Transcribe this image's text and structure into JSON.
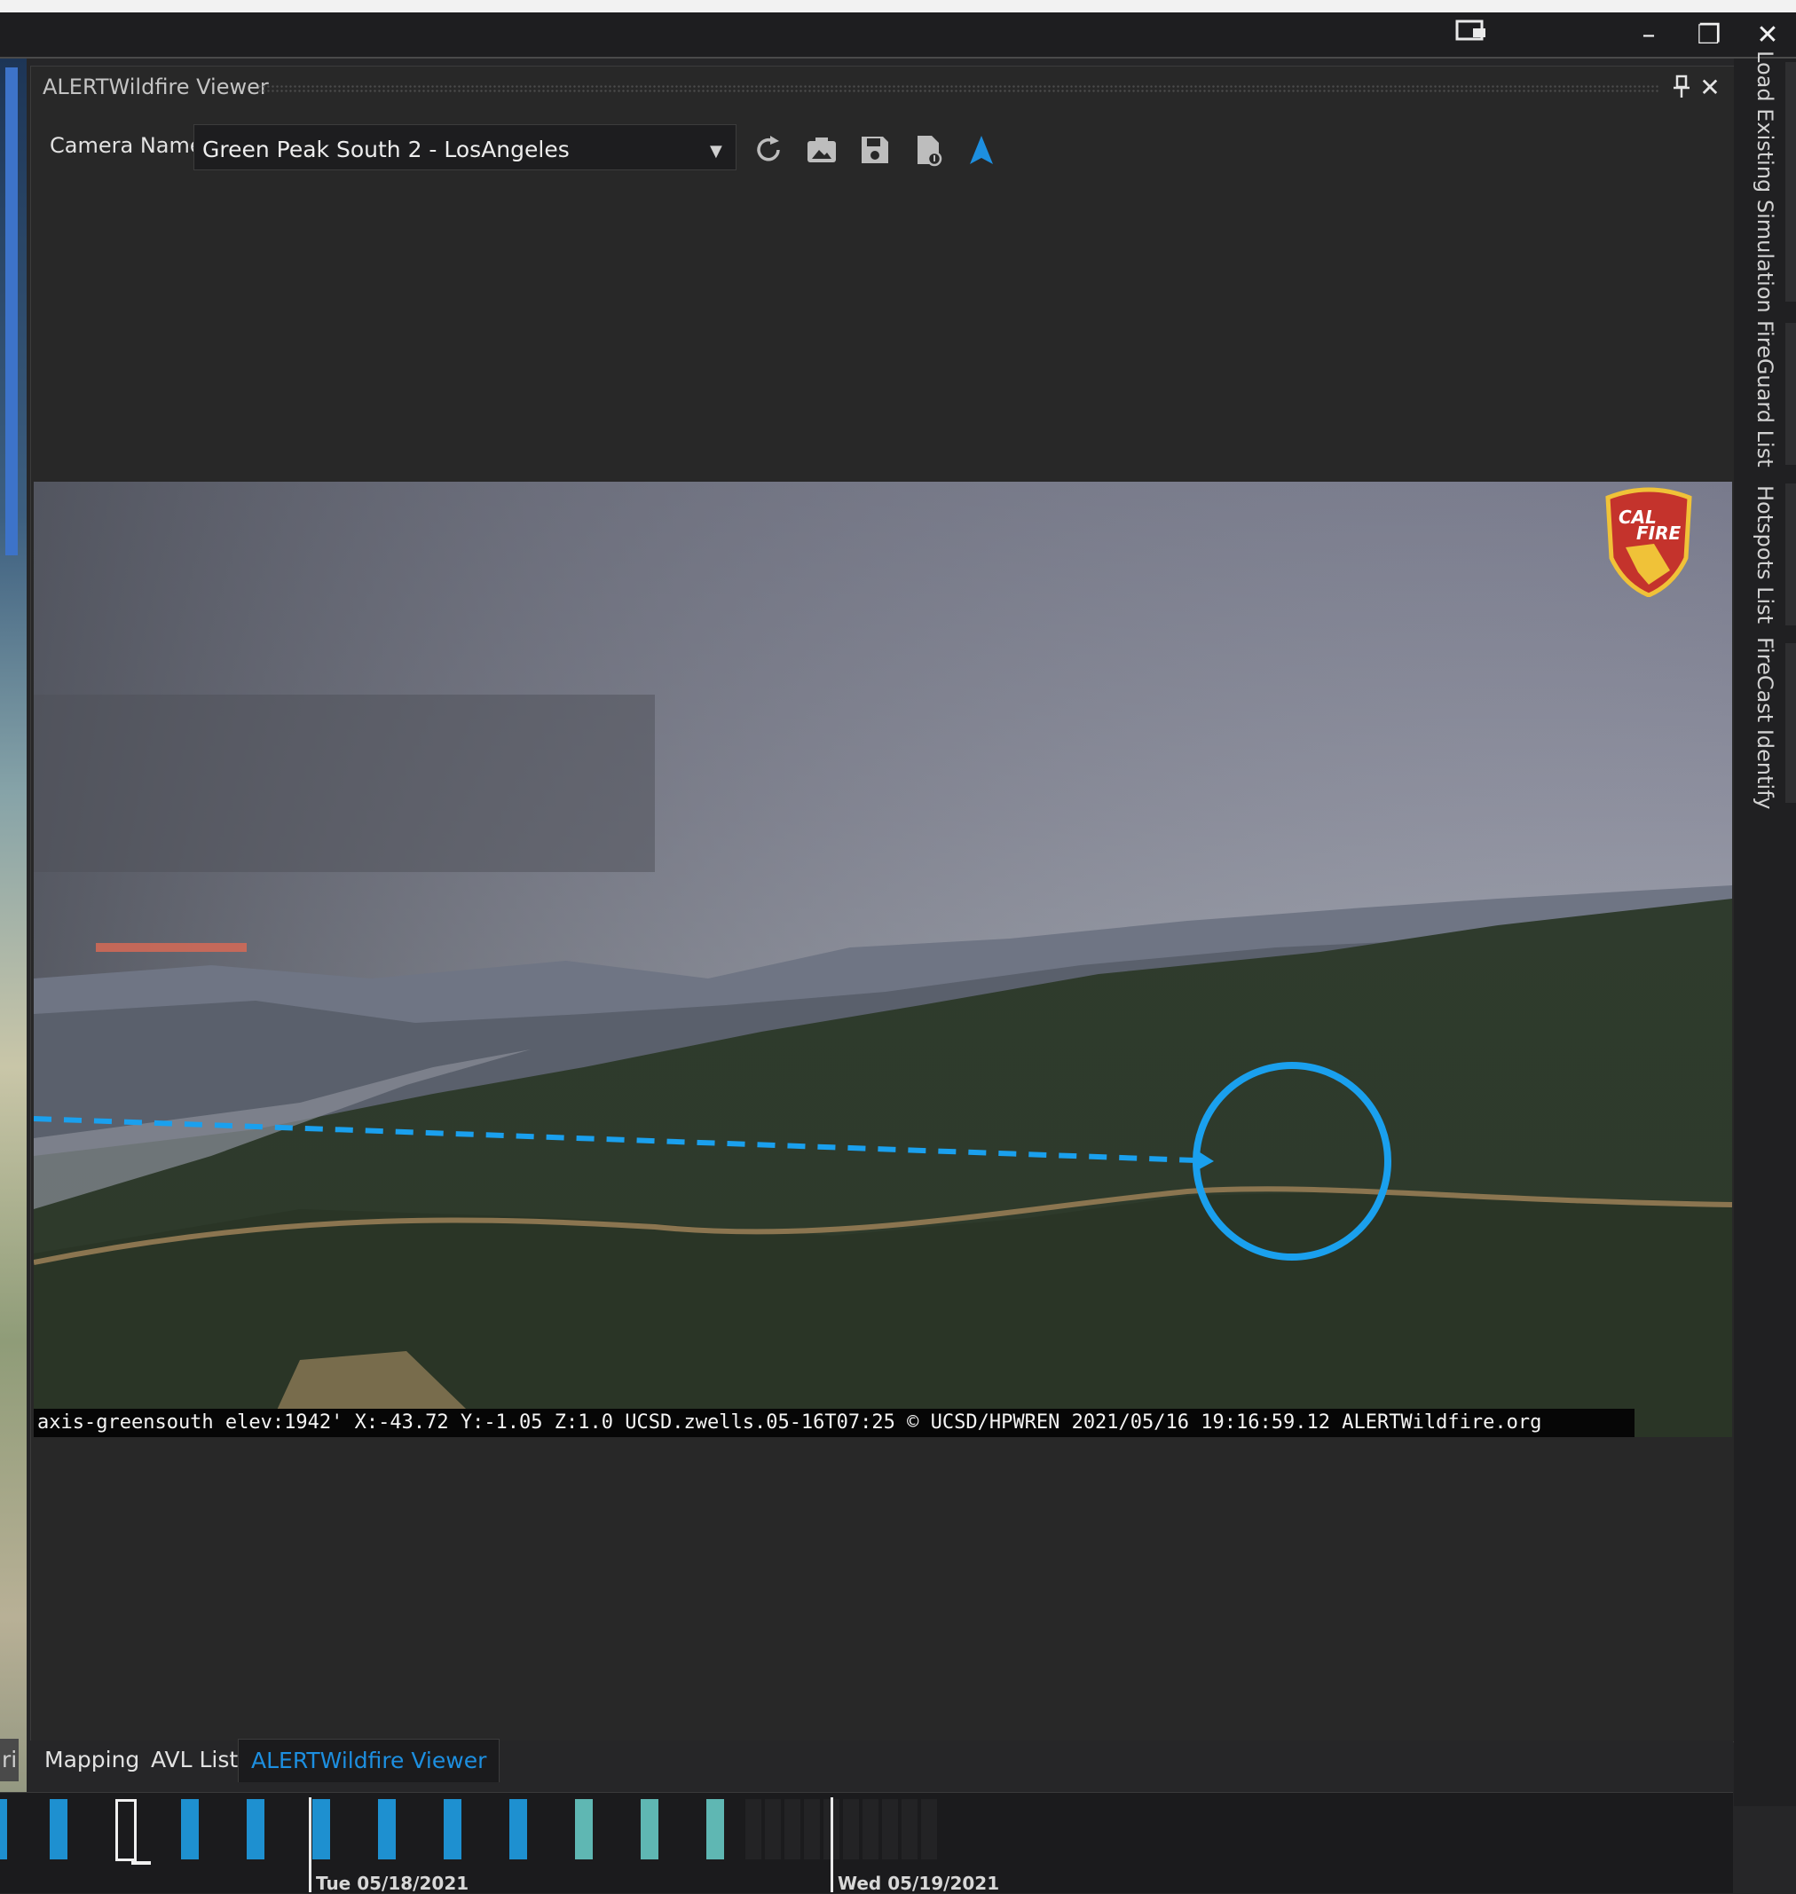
{
  "window": {
    "minimize_glyph": "–",
    "restore_glyph": "❐",
    "close_glyph": "✕"
  },
  "panel": {
    "title": "ALERTWildfire Viewer",
    "camera_label": "Camera Name",
    "camera_value": "Green Peak South 2 - LosAngeles",
    "pin_glyph": "🖈",
    "close_glyph": "✕"
  },
  "feed": {
    "info_text": "axis-greensouth elev:1942' X:-43.72 Y:-1.05 Z:1.0 UCSD.zwells.05-16T07:25 © UCSD/HPWREN 2021/05/16 19:16:59.12 ALERTWildfire.org",
    "logo_line1": "CAL",
    "logo_line2": "FIRE"
  },
  "side_tabs": [
    {
      "label": "Load Existing Simulation"
    },
    {
      "label": "FireGuard List"
    },
    {
      "label": "Hotspots List"
    },
    {
      "label": "FireCast Identify"
    }
  ],
  "bottom_tabs": {
    "partial": "ri",
    "mapping": "Mapping",
    "avl": "AVL List",
    "viewer": "ALERTWildfire Viewer"
  },
  "timeline": {
    "date1": "Tue 05/18/2021",
    "date2": "Wed 05/19/2021"
  },
  "colors": {
    "accent": "#1d8fe0",
    "tick_blue": "#1e90d0",
    "tick_teal": "#5fb7b3",
    "annotation": "#1aa0ee"
  }
}
